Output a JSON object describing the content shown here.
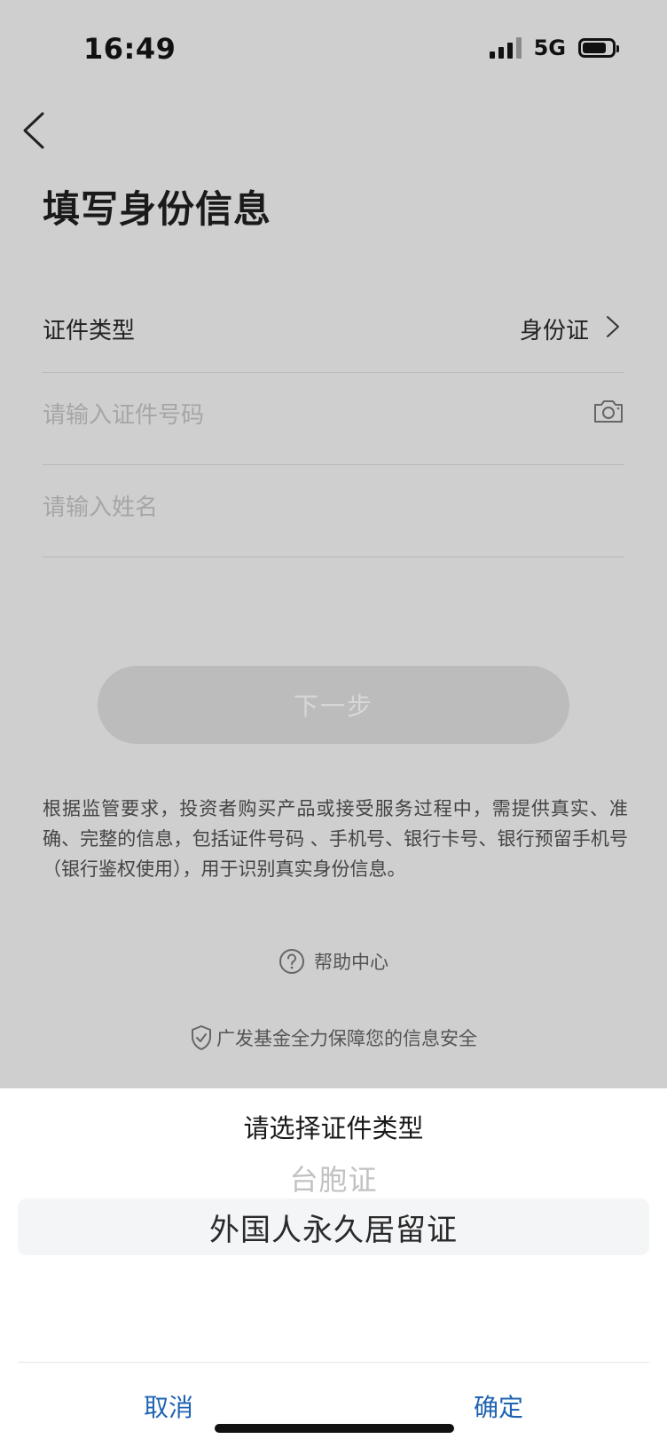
{
  "status_bar": {
    "time": "16:49",
    "network": "5G",
    "battery_level": 0.8
  },
  "header": {
    "back_icon": "chevron-left-icon",
    "title": "填写身份信息"
  },
  "form": {
    "id_type": {
      "label": "证件类型",
      "value": "身份证",
      "icon": "chevron-right-icon"
    },
    "id_number": {
      "placeholder": "请输入证件号码",
      "icon": "camera-icon"
    },
    "name": {
      "placeholder": "请输入姓名"
    }
  },
  "next_button": {
    "label": "下一步",
    "enabled": false
  },
  "disclaimer": "根据监管要求，投资者购买产品或接受服务过程中，需提供真实、准确、完整的信息，包括证件号码 、手机号、银行卡号、银行预留手机号（银行鉴权使用），用于识别真实身份信息。",
  "help": {
    "label": "帮助中心",
    "icon": "question-circle-icon"
  },
  "security_note": {
    "label": "广发基金全力保障您的信息安全",
    "icon": "shield-check-icon"
  },
  "picker": {
    "title": "请选择证件类型",
    "options": [
      "台胞证",
      "外国人永久居留证"
    ],
    "selected": "外国人永久居留证",
    "cancel_label": "取消",
    "confirm_label": "确定"
  },
  "colors": {
    "overlay_bg": "#cfcfcf",
    "accent": "#1f63b3",
    "disabled_button": "#bcbcbc"
  }
}
